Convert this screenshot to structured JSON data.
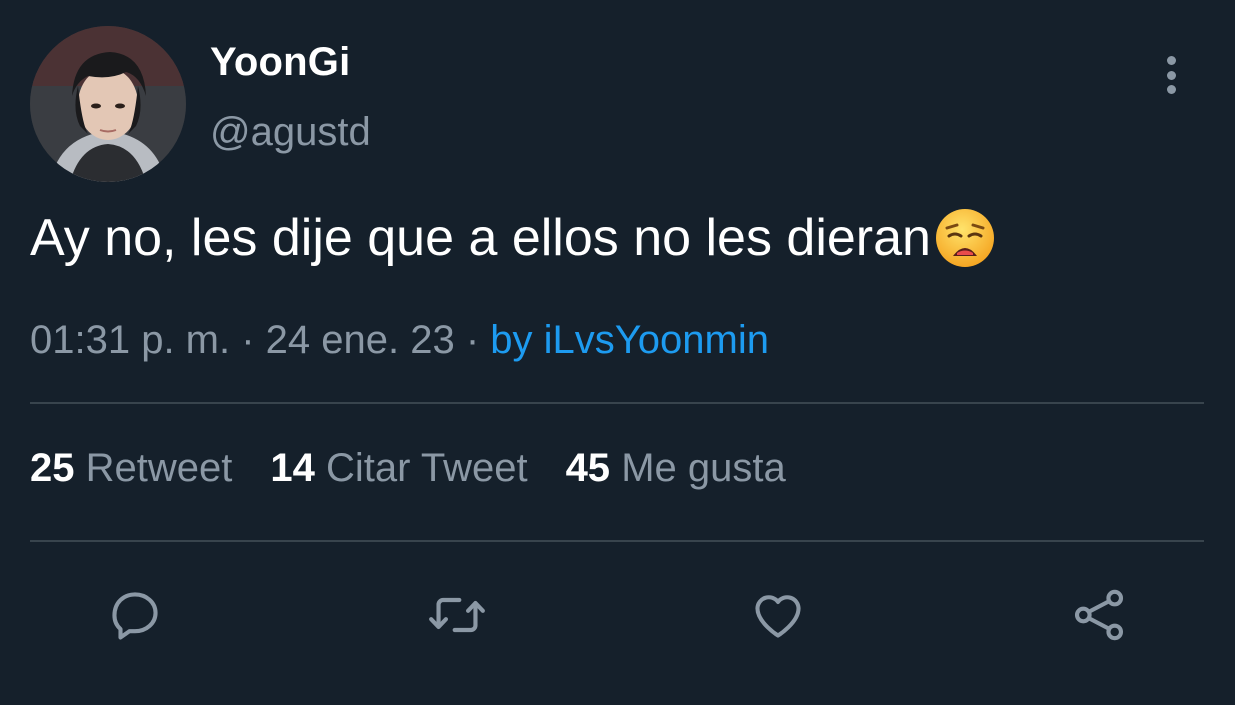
{
  "author": {
    "display_name": "YoonGi",
    "handle": "@agustd"
  },
  "tweet": {
    "text": "Ay no, les dije que a ellos no les dieran",
    "emoji": "weary-face"
  },
  "meta": {
    "time": "01:31 p. m.",
    "separator": " · ",
    "date": "24 ene. 23",
    "separator2": " · ",
    "source": "by iLvsYoonmin"
  },
  "stats": [
    {
      "count": "25",
      "label": "Retweet"
    },
    {
      "count": "14",
      "label": "Citar Tweet"
    },
    {
      "count": "45",
      "label": "Me gusta"
    }
  ],
  "actions": [
    "reply-icon",
    "retweet-icon",
    "like-icon",
    "share-icon"
  ],
  "colors": {
    "background": "#15202b",
    "secondary_text": "#8b98a5",
    "link": "#1d9bf0",
    "divider": "#38444d"
  }
}
